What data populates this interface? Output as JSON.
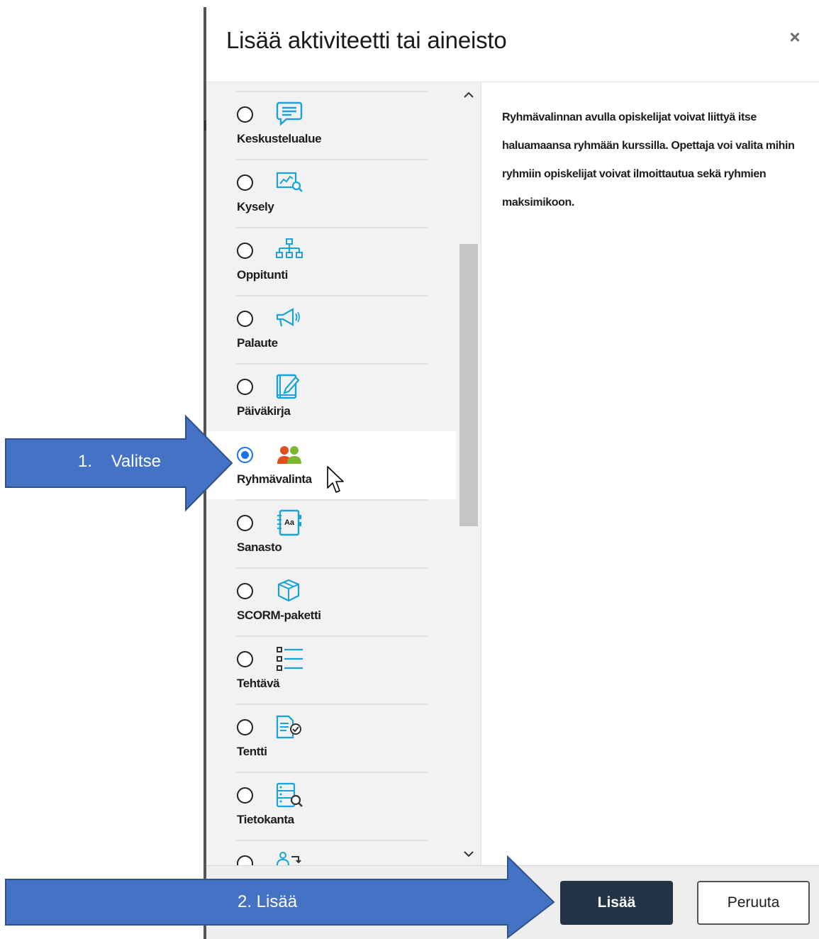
{
  "modal": {
    "title": "Lisää aktiviteetti tai aineisto",
    "close_label": "×"
  },
  "activities": [
    {
      "label": "Keskustelualue",
      "icon": "forum-icon",
      "checked": false
    },
    {
      "label": "Kysely",
      "icon": "survey-chart-icon",
      "checked": false
    },
    {
      "label": "Oppitunti",
      "icon": "lesson-sitemap-icon",
      "checked": false
    },
    {
      "label": "Palaute",
      "icon": "feedback-megaphone-icon",
      "checked": false
    },
    {
      "label": "Päiväkirja",
      "icon": "journal-edit-icon",
      "checked": false
    },
    {
      "label": "Ryhmävalinta",
      "icon": "group-choice-people-icon",
      "checked": true
    },
    {
      "label": "Sanasto",
      "icon": "glossary-book-icon",
      "checked": false
    },
    {
      "label": "SCORM-paketti",
      "icon": "scorm-package-icon",
      "checked": false
    },
    {
      "label": "Tehtävä",
      "icon": "assignment-list-icon",
      "checked": false
    },
    {
      "label": "Tentti",
      "icon": "quiz-check-icon",
      "checked": false
    },
    {
      "label": "Tietokanta",
      "icon": "database-search-icon",
      "checked": false
    },
    {
      "label": "",
      "icon": "workshop-people-icon",
      "checked": false
    }
  ],
  "description": "Ryhmävalinnan avulla opiskelijat voivat liittyä itse haluamaansa ryhmään kurssilla. Opettaja voi valita mihin ryhmiin opiskelijat voivat ilmoittautua sekä ryhmien maksimikoon.",
  "footer": {
    "add_label": "Lisää",
    "cancel_label": "Peruuta"
  },
  "annotations": {
    "step1": "1.    Valitse",
    "step2": "2. Lisää"
  },
  "colors": {
    "icon_blue": "#1aa3d9",
    "arrow_blue": "#4472c4",
    "arrow_border": "#2f528f",
    "primary_button": "#233446",
    "radio_checked": "#1a73e8"
  }
}
